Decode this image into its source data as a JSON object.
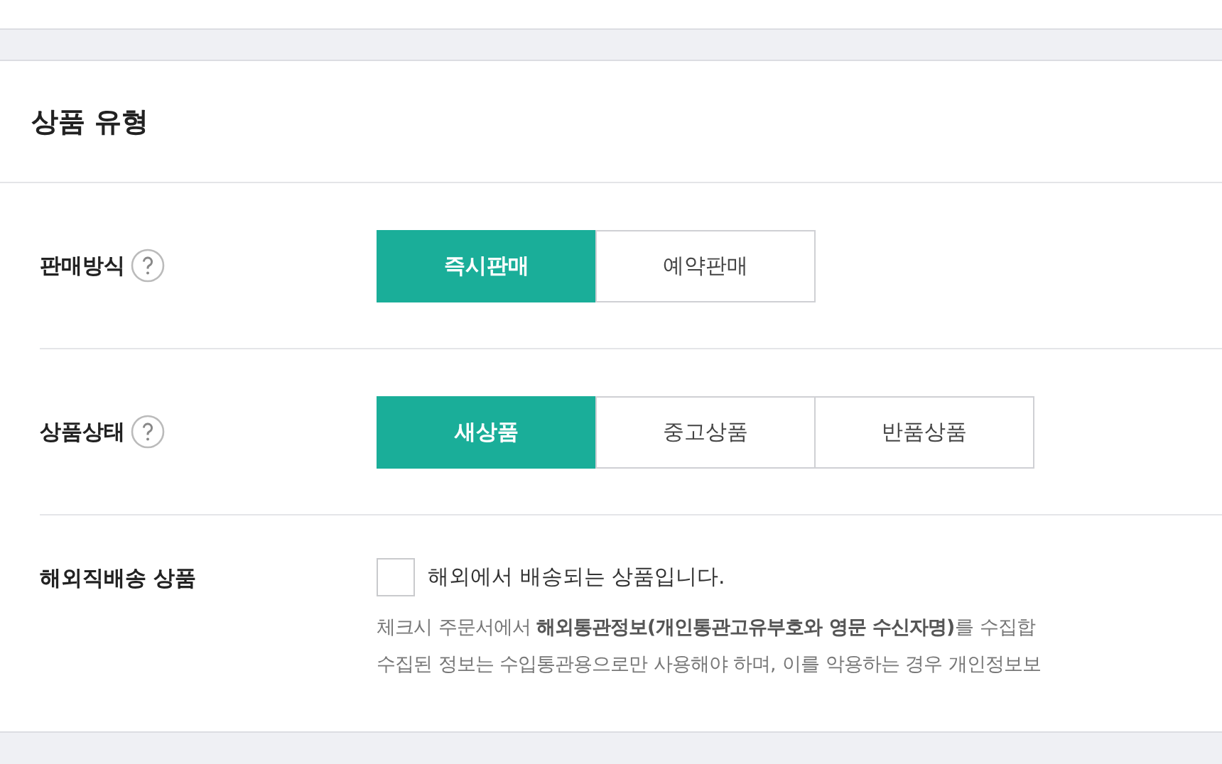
{
  "section": {
    "title": "상품 유형"
  },
  "rows": [
    {
      "kind": "segmented",
      "label": "판매방식",
      "help": true,
      "options": [
        {
          "label": "즉시판매",
          "selected": true
        },
        {
          "label": "예약판매",
          "selected": false
        }
      ]
    },
    {
      "kind": "segmented",
      "label": "상품상태",
      "help": true,
      "options": [
        {
          "label": "새상품",
          "selected": true
        },
        {
          "label": "중고상품",
          "selected": false
        },
        {
          "label": "반품상품",
          "selected": false
        }
      ]
    },
    {
      "kind": "checkbox",
      "label": "해외직배송 상품",
      "help": false,
      "checkbox": {
        "label": "해외에서 배송되는 상품입니다.",
        "checked": false
      },
      "notes": [
        "체크시 주문서에서 **해외통관정보(개인통관고유부호와 영문 수신자명)**를 수집합",
        "수집된 정보는 수입통관용으로만 사용해야 하며, 이를 악용하는 경우 개인정보보"
      ]
    }
  ]
}
